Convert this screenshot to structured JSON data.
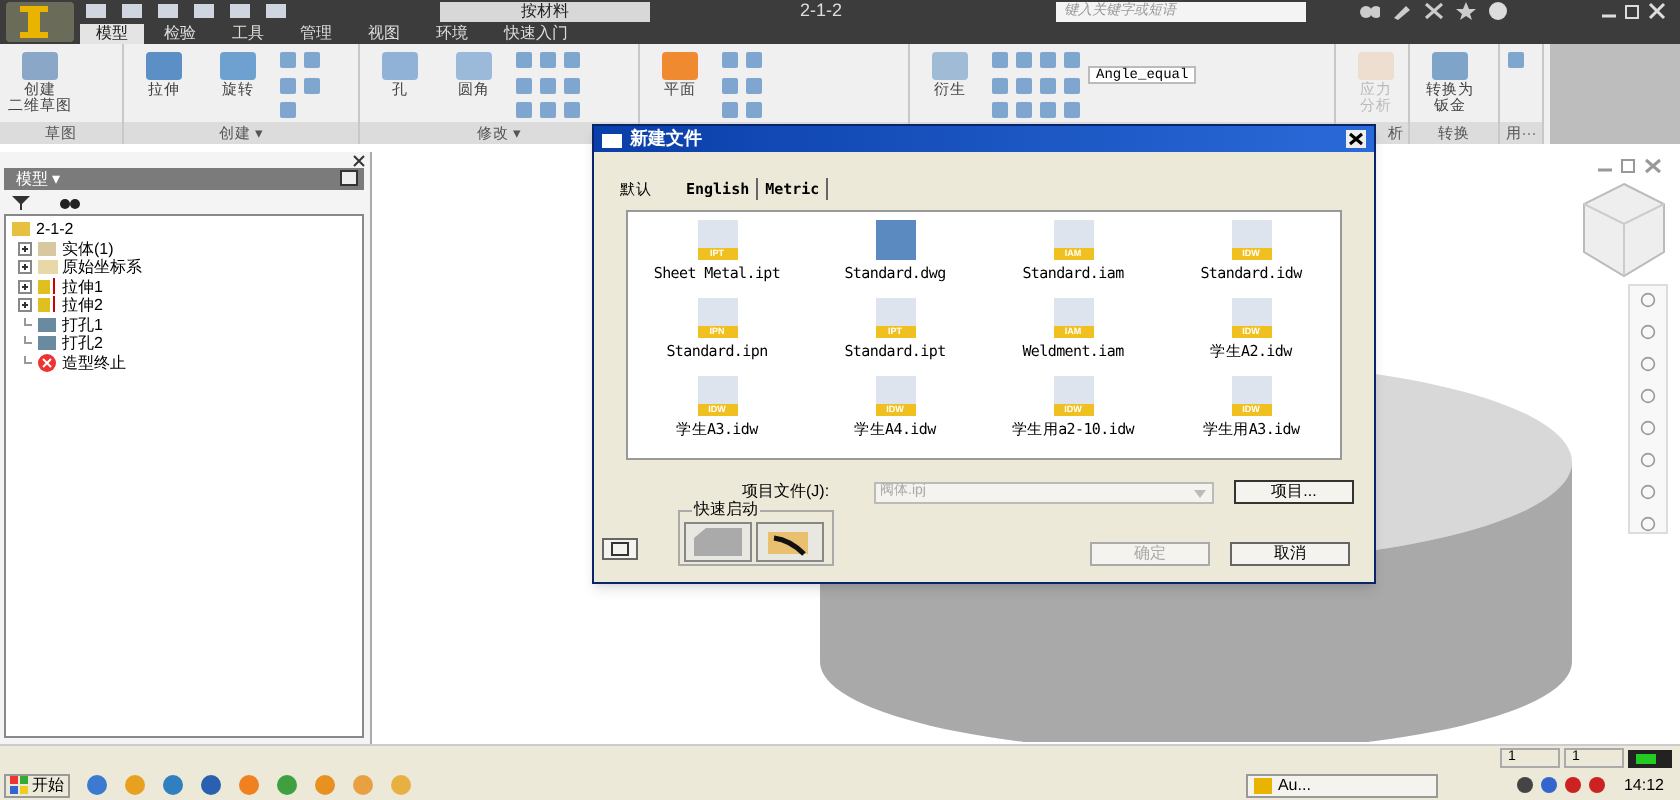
{
  "app": {
    "title": "2-1-2",
    "material": "按材料",
    "search_placeholder": "键入关键字或短语"
  },
  "ribbon_tabs": [
    {
      "label": "模型",
      "selected": true
    },
    {
      "label": "检验",
      "selected": false
    },
    {
      "label": "工具",
      "selected": false
    },
    {
      "label": "管理",
      "selected": false
    },
    {
      "label": "视图",
      "selected": false
    },
    {
      "label": "环境",
      "selected": false
    },
    {
      "label": "快速入门",
      "selected": false
    }
  ],
  "ribbon_panels": [
    {
      "label": "草图",
      "buttons": [
        {
          "label_lines": [
            "创建",
            "二维草图"
          ],
          "kind": "sketch",
          "disabled": false
        }
      ]
    },
    {
      "label": "创建 ▾",
      "buttons": [
        {
          "label_lines": [
            "拉伸"
          ],
          "kind": "extrude",
          "disabled": false
        },
        {
          "label_lines": [
            "旋转"
          ],
          "kind": "revolve",
          "disabled": false
        }
      ]
    },
    {
      "label": "修改 ▾",
      "buttons": [
        {
          "label_lines": [
            "孔"
          ],
          "kind": "hole",
          "disabled": false
        },
        {
          "label_lines": [
            "圆角"
          ],
          "kind": "fillet",
          "disabled": false
        }
      ]
    },
    {
      "buttons": [
        {
          "label_lines": [
            "平面"
          ],
          "kind": "plane",
          "disabled": false
        }
      ]
    },
    {
      "buttons": [
        {
          "label_lines": [
            "衍生"
          ],
          "kind": "derive",
          "disabled": false
        }
      ],
      "dropdown": "Angle_equal"
    },
    {
      "label": "析",
      "buttons": [
        {
          "label_lines": [
            "应力",
            "分析"
          ],
          "kind": "stress",
          "disabled": true
        }
      ]
    },
    {
      "label": "转换",
      "buttons": [
        {
          "label_lines": [
            "转换为",
            "钣金"
          ],
          "kind": "sheet",
          "disabled": false
        }
      ]
    },
    {
      "label": "用···"
    }
  ],
  "model_panel": {
    "title": "模型 ▾",
    "tree": [
      {
        "label": "2-1-2",
        "kind": "part",
        "expandable": false,
        "children": [
          {
            "label": "实体(1)",
            "kind": "bodies",
            "expandable": true
          },
          {
            "label": "原始坐标系",
            "kind": "folder",
            "expandable": true
          },
          {
            "label": "拉伸1",
            "kind": "extrude",
            "expandable": true
          },
          {
            "label": "拉伸2",
            "kind": "extrude",
            "expandable": true
          },
          {
            "label": "打孔1",
            "kind": "hole",
            "expandable": false
          },
          {
            "label": "打孔2",
            "kind": "hole",
            "expandable": false
          },
          {
            "label": "造型终止",
            "kind": "end",
            "expandable": false
          }
        ]
      }
    ]
  },
  "dialog": {
    "title": "新建文件",
    "tabs": [
      {
        "label": "默认",
        "selected": true
      },
      {
        "label": "English",
        "selected": false
      },
      {
        "label": "Metric",
        "selected": false
      }
    ],
    "files": [
      {
        "label": "Sheet Metal.ipt",
        "kind": "ipt",
        "badge": "IPT"
      },
      {
        "label": "Standard.dwg",
        "kind": "dwg"
      },
      {
        "label": "Standard.iam",
        "kind": "iam",
        "badge": "IAM"
      },
      {
        "label": "Standard.idw",
        "kind": "idw",
        "badge": "IDW"
      },
      {
        "label": "Standard.ipn",
        "kind": "ipn",
        "badge": "IPN"
      },
      {
        "label": "Standard.ipt",
        "kind": "ipt",
        "badge": "IPT"
      },
      {
        "label": "Weldment.iam",
        "kind": "iam",
        "badge": "IAM"
      },
      {
        "label": "学生A2.idw",
        "kind": "idw",
        "badge": "IDW"
      },
      {
        "label": "学生A3.idw",
        "kind": "idw",
        "badge": "IDW"
      },
      {
        "label": "学生A4.idw",
        "kind": "idw",
        "badge": "IDW"
      },
      {
        "label": "学生用a2-10.idw",
        "kind": "idw",
        "badge": "IDW"
      },
      {
        "label": "学生用A3.idw",
        "kind": "idw",
        "badge": "IDW"
      }
    ],
    "project_label": "项目文件(J):",
    "project_value": "阀体.ipj",
    "project_button": "项目...",
    "quick_launch": "快速启动",
    "ok": {
      "label": "确定",
      "disabled": true
    },
    "cancel": {
      "label": "取消",
      "disabled": false
    }
  },
  "status_bar": [
    "1",
    "1"
  ],
  "taskbar": {
    "start": "开始",
    "tasks": [
      "Au..."
    ],
    "clock": "14:12"
  }
}
